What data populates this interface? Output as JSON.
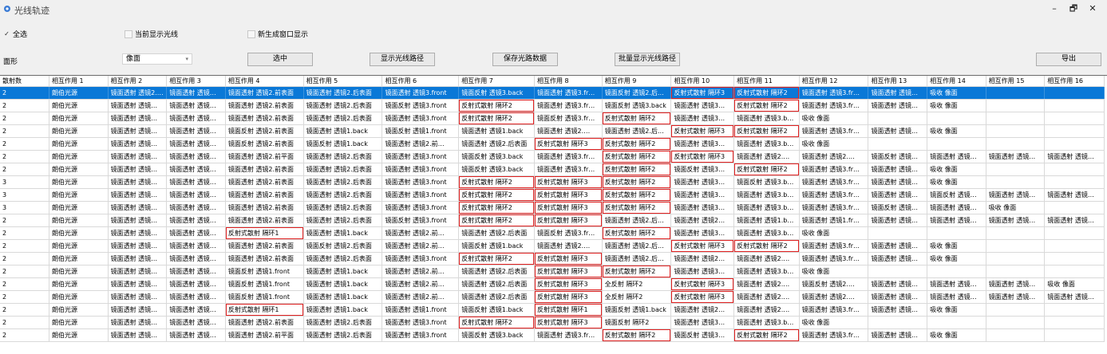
{
  "window": {
    "title": "光线轨迹",
    "minimize": "–",
    "restore": "🗗",
    "close": "✕"
  },
  "options": {
    "select_all": "全选",
    "select_all_checked": "✓",
    "show_current_only": "当前显示光线",
    "new_window_display": "新生成窗口显示"
  },
  "face": {
    "label": "面形",
    "value": "像面",
    "arrow": "▾"
  },
  "buttons": {
    "select": "选中",
    "show_path": "显示光线路径",
    "save_data": "保存光路数据",
    "batch_show": "批量显示光线路径",
    "export": "导出"
  },
  "table": {
    "columns": [
      "散射数",
      "相互作用 1",
      "相互作用 2",
      "相互作用 3",
      "相互作用 4",
      "相互作用 5",
      "相互作用 6",
      "相互作用 7",
      "相互作用 8",
      "相互作用 9",
      "相互作用 10",
      "相互作用 11",
      "相互作用 12",
      "相互作用 13",
      "相互作用 14",
      "相互作用 15",
      "相互作用 16"
    ],
    "rows": [
      [
        "2",
        "朗伯光源",
        "镜面透射 透镜2.前…",
        "镜面透射 透镜…",
        "镜面透射 透镜2.前表面",
        "镜面透射 透镜2.后表面",
        "镜面透射 透镜3.front",
        "镜面反射 透镜3.back",
        "镜面透射 透镜3.fr…",
        "镜面反射 透镜2.后…",
        "反射式散射 隔环3",
        "反射式散射 隔环2",
        "镜面透射 透镜3.fr…",
        "镜面透射 透镜…",
        "吸收 像面",
        "",
        ""
      ],
      [
        "2",
        "朗伯光源",
        "镜面透射 透镜…",
        "镜面透射 透镜…",
        "镜面透射 透镜2.前表面",
        "镜面透射 透镜2.后表面",
        "镜面反射 透镜3.front",
        "反射式散射 隔环2",
        "镜面透射 透镜3.fr…",
        "镜面反射 透镜3.back",
        "镜面透射 透镜3…",
        "反射式散射 隔环2",
        "镜面透射 透镜3.fr…",
        "镜面透射 透镜…",
        "吸收 像面",
        "",
        ""
      ],
      [
        "2",
        "朗伯光源",
        "镜面透射 透镜…",
        "镜面透射 透镜…",
        "镜面透射 透镜2.前表面",
        "镜面透射 透镜2.后表面",
        "镜面透射 透镜3.front",
        "反射式散射 隔环2",
        "镜面反射 透镜3.fr…",
        "反射式散射 隔环2",
        "镜面透射 透镜3…",
        "镜面透射 透镜3.b…",
        "吸收 像面",
        "",
        "",
        "",
        ""
      ],
      [
        "2",
        "朗伯光源",
        "镜面透射 透镜…",
        "镜面透射 透镜…",
        "镜面反射 透镜2.前表面",
        "镜面透射 透镜1.back",
        "镜面反射 透镜1.front",
        "镜面透射 透镜1.back",
        "镜面透射 透镜2.…",
        "镜面透射 透镜2.后…",
        "反射式散射 隔环3",
        "反射式散射 隔环2",
        "镜面透射 透镜3.fr…",
        "镜面透射 透镜…",
        "吸收 像面",
        "",
        ""
      ],
      [
        "2",
        "朗伯光源",
        "镜面透射 透镜…",
        "镜面透射 透镜…",
        "镜面反射 透镜2.前表面",
        "镜面反射 透镜1.back",
        "镜面透射 透镜2.前…",
        "镜面透射 透镜2.后表面",
        "反射式散射 隔环3",
        "反射式散射 隔环2",
        "镜面透射 透镜3…",
        "镜面透射 透镜3.b…",
        "吸收 像面",
        "",
        "",
        "",
        ""
      ],
      [
        "2",
        "朗伯光源",
        "镜面透射 透镜…",
        "镜面透射 透镜…",
        "镜面透射 透镜2.前平面",
        "镜面透射 透镜2.后表面",
        "镜面透射 透镜3.front",
        "镜面反射 透镜3.back",
        "镜面透射 透镜3.fr…",
        "反射式散射 隔环2",
        "反射式散射 隔环3",
        "镜面透射 透镜2.…",
        "镜面透射 透镜2.…",
        "镜面反射 透镜…",
        "镜面透射 透镜…",
        "镜面透射 透镜…",
        "镜面透射 透镜…"
      ],
      [
        "2",
        "朗伯光源",
        "镜面透射 透镜…",
        "镜面透射 透镜…",
        "镜面透射 透镜2.前表面",
        "镜面透射 透镜2.后表面",
        "镜面透射 透镜3.front",
        "镜面反射 透镜3.back",
        "镜面透射 透镜3.fr…",
        "反射式散射 隔环2",
        "镜面反射 透镜3…",
        "反射式散射 隔环2",
        "镜面透射 透镜3.fr…",
        "镜面透射 透镜…",
        "吸收 像面",
        "",
        ""
      ],
      [
        "3",
        "朗伯光源",
        "镜面透射 透镜…",
        "镜面透射 透镜…",
        "镜面透射 透镜2.前表面",
        "镜面透射 透镜2.后表面",
        "镜面透射 透镜3.front",
        "反射式散射 隔环2",
        "反射式散射 隔环3",
        "反射式散射 隔环2",
        "镜面透射 透镜3…",
        "镜面反射 透镜3.b…",
        "镜面透射 透镜3.fr…",
        "镜面透射 透镜…",
        "吸收 像面",
        "",
        ""
      ],
      [
        "3",
        "朗伯光源",
        "镜面透射 透镜…",
        "镜面透射 透镜…",
        "镜面透射 透镜2.前表面",
        "镜面透射 透镜2.后表面",
        "镜面透射 透镜3.front",
        "反射式散射 隔环2",
        "反射式散射 隔环3",
        "反射式散射 隔环2",
        "镜面透射 透镜3…",
        "镜面透射 透镜3.b…",
        "镜面透射 透镜3.fr…",
        "镜面透射 透镜…",
        "镜面反射 透镜…",
        "镜面透射 透镜…",
        "镜面透射 透镜…"
      ],
      [
        "3",
        "朗伯光源",
        "镜面透射 透镜…",
        "镜面透射 透镜…",
        "镜面透射 透镜2.前表面",
        "镜面透射 透镜2.后表面",
        "镜面透射 透镜3.front",
        "反射式散射 隔环2",
        "反射式散射 隔环3",
        "反射式散射 隔环2",
        "镜面透射 透镜3…",
        "镜面透射 透镜3.b…",
        "镜面透射 透镜3.fr…",
        "镜面反射 透镜…",
        "镜面透射 透镜…",
        "吸收 像面",
        ""
      ],
      [
        "2",
        "朗伯光源",
        "镜面透射 透镜…",
        "镜面透射 透镜…",
        "镜面透射 透镜2.前表面",
        "镜面透射 透镜2.后表面",
        "镜面反射 透镜3.front",
        "反射式散射 隔环2",
        "反射式散射 隔环3",
        "镜面透射 透镜2.后…",
        "镜面透射 透镜2…",
        "镜面透射 透镜1.b…",
        "镜面透射 透镜1.fr…",
        "镜面透射 透镜…",
        "镜面透射 透镜…",
        "镜面透射 透镜…",
        "镜面透射 透镜…"
      ],
      [
        "2",
        "朗伯光源",
        "镜面透射 透镜…",
        "镜面透射 透镜…",
        "反射式散射 隔环1",
        "镜面透射 透镜1.back",
        "镜面透射 透镜2.前…",
        "镜面透射 透镜2.后表面",
        "镜面反射 透镜3.fr…",
        "反射式散射 隔环2",
        "镜面透射 透镜3…",
        "镜面透射 透镜3.b…",
        "吸收 像面",
        "",
        "",
        "",
        ""
      ],
      [
        "2",
        "朗伯光源",
        "镜面透射 透镜…",
        "镜面透射 透镜…",
        "镜面透射 透镜2.前表面",
        "镜面反射 透镜2.后表面",
        "镜面透射 透镜2.前…",
        "镜面反射 透镜1.back",
        "镜面透射 透镜2.…",
        "镜面透射 透镜2.后…",
        "反射式散射 隔环3",
        "反射式散射 隔环2",
        "镜面透射 透镜3.fr…",
        "镜面透射 透镜…",
        "吸收 像面",
        "",
        ""
      ],
      [
        "2",
        "朗伯光源",
        "镜面透射 透镜…",
        "镜面透射 透镜…",
        "镜面透射 透镜2.前表面",
        "镜面透射 透镜2.后表面",
        "镜面透射 透镜3.front",
        "反射式散射 隔环2",
        "反射式散射 隔环3",
        "镜面透射 透镜2.后…",
        "镜面透射 透镜2…",
        "镜面透射 透镜2.…",
        "镜面透射 透镜3.fr…",
        "镜面透射 透镜…",
        "吸收 像面",
        "",
        ""
      ],
      [
        "2",
        "朗伯光源",
        "镜面透射 透镜…",
        "镜面透射 透镜…",
        "镜面反射 透镜1.front",
        "镜面透射 透镜1.back",
        "镜面透射 透镜2.前…",
        "镜面透射 透镜2.后表面",
        "反射式散射 隔环3",
        "反射式散射 隔环2",
        "镜面透射 透镜3…",
        "镜面透射 透镜3.b…",
        "吸收 像面",
        "",
        "",
        "",
        ""
      ],
      [
        "2",
        "朗伯光源",
        "镜面透射 透镜…",
        "镜面透射 透镜…",
        "镜面反射 透镜1.front",
        "镜面透射 透镜1.back",
        "镜面透射 透镜2.前…",
        "镜面透射 透镜2.后表面",
        "反射式散射 隔环3",
        "全反射 隔环2",
        "反射式散射 隔环3",
        "镜面透射 透镜2.…",
        "镜面反射 透镜2.…",
        "镜面透射 透镜…",
        "镜面透射 透镜…",
        "镜面透射 透镜…",
        "吸收 像面"
      ],
      [
        "2",
        "朗伯光源",
        "镜面透射 透镜…",
        "镜面透射 透镜…",
        "镜面反射 透镜1.front",
        "镜面透射 透镜1.back",
        "镜面透射 透镜2.前…",
        "镜面透射 透镜2.后表面",
        "反射式散射 隔环3",
        "全反射 隔环2",
        "反射式散射 隔环3",
        "镜面透射 透镜2.…",
        "镜面透射 透镜2.…",
        "镜面透射 透镜…",
        "镜面透射 透镜…",
        "镜面透射 透镜…",
        "镜面透射 透镜…"
      ],
      [
        "2",
        "朗伯光源",
        "镜面透射 透镜…",
        "镜面透射 透镜…",
        "反射式散射 隔环1",
        "镜面透射 透镜1.back",
        "镜面透射 透镜1.front",
        "镜面反射 透镜1.back",
        "反射式散射 隔环1",
        "镜面反射 透镜1.back",
        "镜面透射 透镜2…",
        "镜面透射 透镜2.…",
        "镜面透射 透镜3.fr…",
        "镜面透射 透镜…",
        "吸收 像面",
        "",
        ""
      ],
      [
        "2",
        "朗伯光源",
        "镜面透射 透镜…",
        "镜面透射 透镜…",
        "镜面透射 透镜2.前表面",
        "镜面透射 透镜2.后表面",
        "镜面透射 透镜3.front",
        "反射式散射 隔环2",
        "反射式散射 隔环3",
        "镜面反射 隔环2",
        "镜面透射 透镜3…",
        "镜面透射 透镜3.b…",
        "吸收 像面",
        "",
        "",
        "",
        ""
      ],
      [
        "2",
        "朗伯光源",
        "镜面透射 透镜…",
        "镜面透射 透镜…",
        "镜面透射 透镜2.前平面",
        "镜面透射 透镜2.后表面",
        "镜面透射 透镜3.front",
        "镜面反射 透镜3.back",
        "镜面透射 透镜3.fr…",
        "反射式散射 隔环2",
        "镜面反射 透镜3…",
        "反射式散射 隔环2",
        "镜面透射 透镜3.fr…",
        "镜面透射 透镜…",
        "吸收 像面",
        "",
        ""
      ]
    ],
    "selected_row": 0
  },
  "colors": {
    "selected_bg": "#0a78d7",
    "highlight_border": "#e02020"
  }
}
